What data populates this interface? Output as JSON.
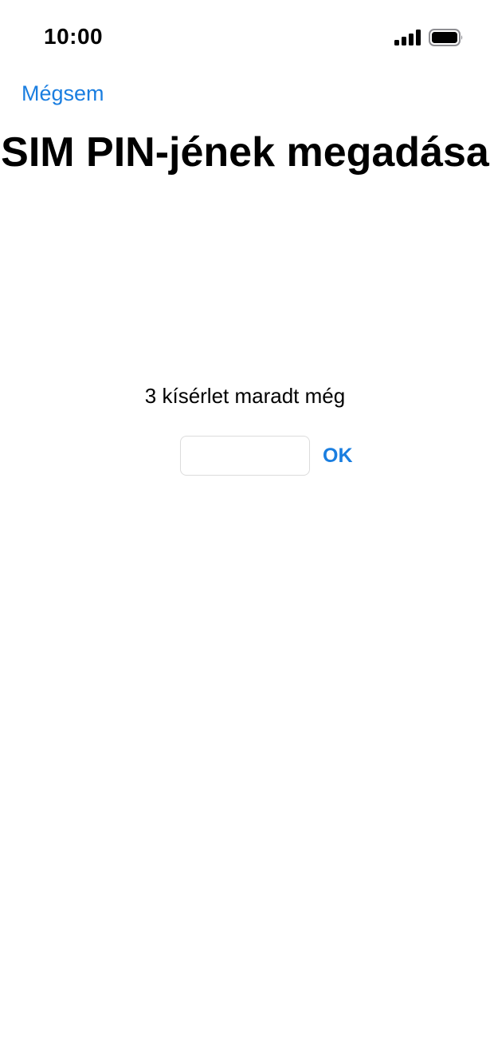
{
  "status_bar": {
    "time": "10:00",
    "signal_icon": "cellular-signal-icon",
    "battery_icon": "battery-icon"
  },
  "nav": {
    "cancel_label": "Mégsem"
  },
  "page": {
    "title": "SIM PIN-jének megadása",
    "attempts_text": "3 kísérlet maradt még"
  },
  "pin_form": {
    "pin_value": "",
    "ok_label": "OK"
  },
  "colors": {
    "accent": "#1a7ee0",
    "text": "#000000",
    "background": "#ffffff",
    "input_border": "#dcdcdc"
  }
}
